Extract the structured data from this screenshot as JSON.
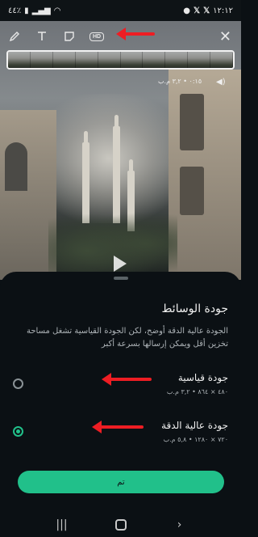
{
  "status_bar": {
    "left_text": "٤٤٪",
    "time": "١٢:١٢"
  },
  "toolbar": {
    "hd_label": "HD"
  },
  "video": {
    "meta": "٠:١٥ • ٣,٢ م.ب"
  },
  "sheet": {
    "title": "جودة الوسائط",
    "description": "الجودة عالية الدقة أوضح، لكن الجودة القياسية تشغل مساحة تخزين أقل ويمكن إرسالها بسرعة أكبر",
    "options": [
      {
        "label": "جودة قياسية",
        "details": "٤٨٠ × ٨٦٤ • ٣,٢ م.ب",
        "selected": false
      },
      {
        "label": "جودة عالية الدقة",
        "details": "٧٢٠ × ١٢٨٠ • ٥,٨ م.ب",
        "selected": true
      }
    ],
    "done_label": "تم"
  },
  "colors": {
    "accent": "#21c08a",
    "annotation_arrow": "#ee1d23",
    "sheet_background": "#0b1014"
  }
}
